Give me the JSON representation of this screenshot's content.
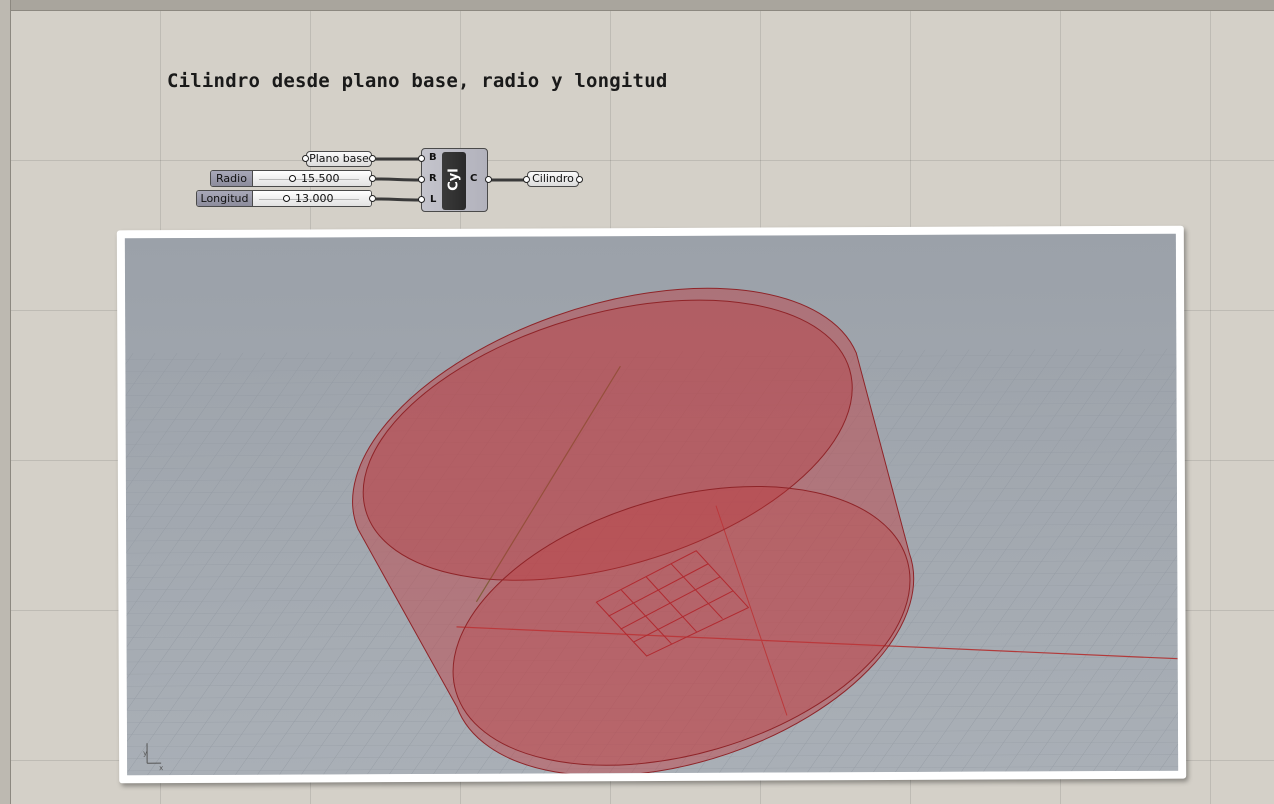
{
  "canvas": {
    "title": "Cilindro desde plano base, radio y longitud"
  },
  "nodes": {
    "plane_param": {
      "label": "Plano base"
    },
    "radius_slider": {
      "label": "Radio",
      "value": "15.500"
    },
    "length_slider": {
      "label": "Longitud",
      "value": "13.000"
    },
    "cylinder_component": {
      "nickname": "Cyl",
      "inputs": [
        "B",
        "R",
        "L"
      ],
      "output": "C"
    },
    "output_param": {
      "label": "Cilindro"
    }
  },
  "viewport": {
    "axis_indicator": {
      "x": "x",
      "y": "y"
    },
    "colors": {
      "background": "#a4aab1",
      "cylinder": "#c0393d",
      "grid": "#8e959e",
      "x_axis": "#b23a3a",
      "y_axis": "#4f7a3a"
    }
  }
}
